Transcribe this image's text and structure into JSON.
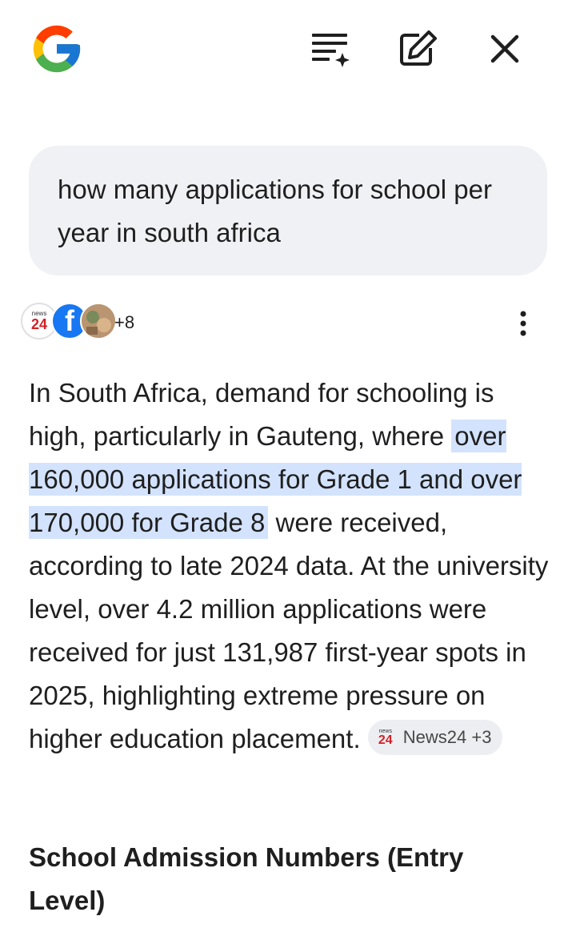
{
  "query": {
    "text": "how many applications for school per year in south africa"
  },
  "sources": {
    "count_label": "+8",
    "avatar_news24_text": "24",
    "avatar_news24_small": "news",
    "avatar_facebook_text": "f"
  },
  "answer": {
    "text_before": "In South Africa, demand for schooling is high, particularly in Gauteng, where ",
    "highlight": "over 160,000 applications for Grade 1 and over 170,000 for Grade 8",
    "text_after": " were received, according to late 2024 data. At the university level, over 4.2 million applications were received for just 131,987 first-year spots in 2025, highlighting extreme pressure on higher education placement. ",
    "chip_label": "News24 +3",
    "chip_logo_small": "news",
    "chip_logo_big": "24"
  },
  "section_heading": "School Admission Numbers (Entry Level)",
  "colors": {
    "highlight": "#d3e3fd",
    "bubble": "#f0f1f5",
    "news24_red": "#d32027",
    "facebook_blue": "#1877f2"
  },
  "icons": [
    "google-logo-icon",
    "ai-mode-list-icon",
    "edit-icon",
    "close-icon",
    "more-vert-icon"
  ]
}
